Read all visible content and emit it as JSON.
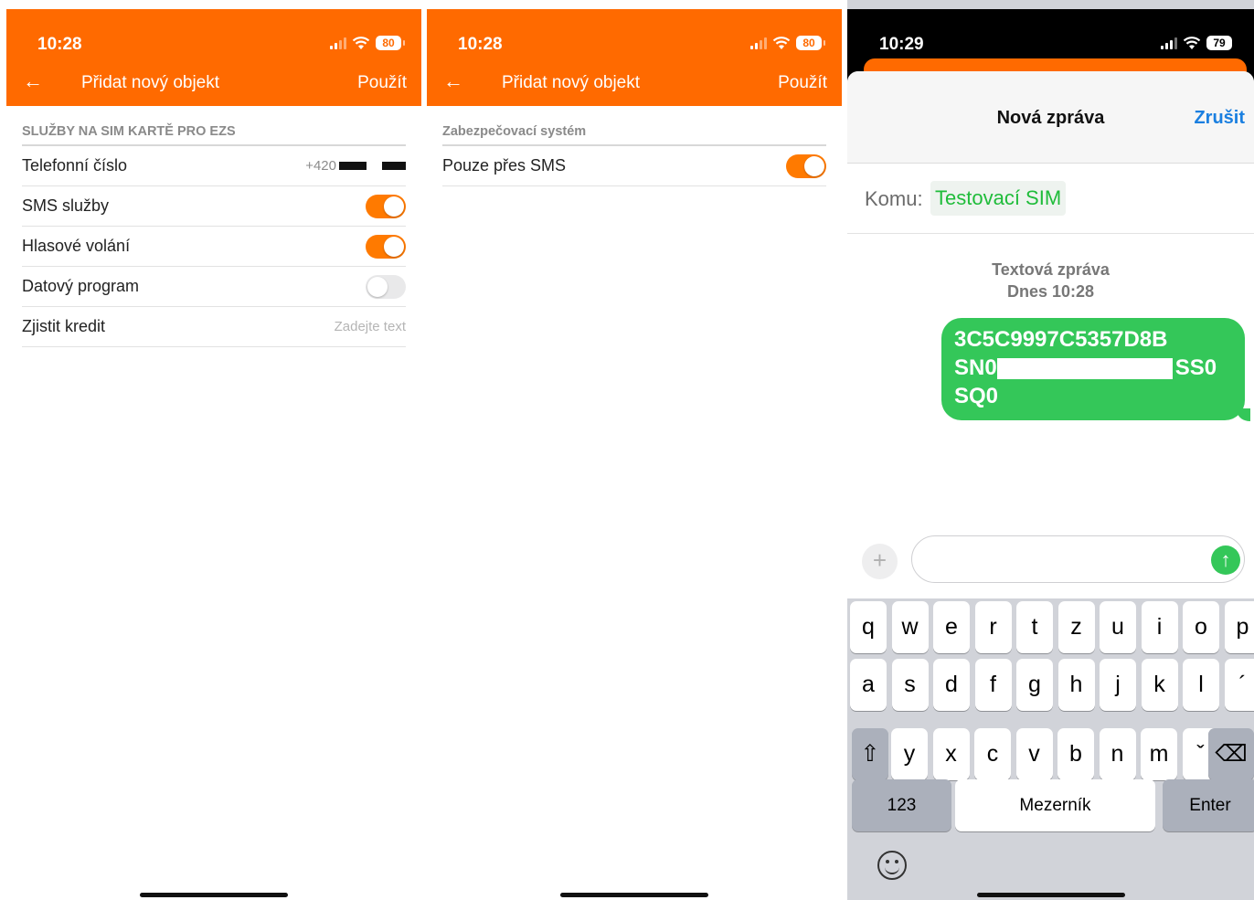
{
  "screen1": {
    "status": {
      "time": "10:28",
      "battery": "80"
    },
    "nav": {
      "title": "Přidat nový objekt",
      "action": "Použít"
    },
    "section_header": "SLUŽBY NA SIM KARTĚ PRO EZS",
    "rows": [
      {
        "label": "Telefonní číslo",
        "value": "+420"
      },
      {
        "label": "SMS služby",
        "toggle": true
      },
      {
        "label": "Hlasové volání",
        "toggle": true
      },
      {
        "label": "Datový program",
        "toggle": false
      },
      {
        "label": "Zjistit kredit",
        "placeholder": "Zadejte text"
      }
    ]
  },
  "screen2": {
    "status": {
      "time": "10:28",
      "battery": "80"
    },
    "nav": {
      "title": "Přidat nový objekt",
      "action": "Použít"
    },
    "section_header": "Zabezpečovací systém",
    "rows": [
      {
        "label": "Pouze přes SMS",
        "toggle": true
      }
    ]
  },
  "screen3": {
    "status": {
      "time": "10:29",
      "battery": "79"
    },
    "sheet": {
      "title": "Nová zpráva",
      "cancel": "Zrušit"
    },
    "to": {
      "label": "Komu:",
      "recipient": "Testovací SIM"
    },
    "message_meta": {
      "type": "Textová zpráva",
      "time": "Dnes 10:28"
    },
    "message": {
      "line1": "3C5C9997C5357D8B",
      "line2_start": "SN0",
      "line2_end": "SS0",
      "line3": "SQ0"
    },
    "keyboard": {
      "row1": [
        "q",
        "w",
        "e",
        "r",
        "t",
        "z",
        "u",
        "i",
        "o",
        "p"
      ],
      "row2": [
        "a",
        "s",
        "d",
        "f",
        "g",
        "h",
        "j",
        "k",
        "l",
        "´"
      ],
      "row3": [
        "y",
        "x",
        "c",
        "v",
        "b",
        "n",
        "m",
        "ˇ"
      ],
      "numbers": "123",
      "space": "Mezerník",
      "enter": "Enter"
    }
  },
  "colors": {
    "brand_orange": "#ff6a00",
    "toggle_on": "#ff7a00",
    "imessage_green": "#34c759",
    "link_blue": "#1a7fe0"
  },
  "icons": [
    "back-arrow-icon",
    "signal-icon",
    "wifi-icon",
    "battery-icon",
    "plus-icon",
    "send-arrow-icon",
    "shift-icon",
    "delete-icon",
    "emoji-icon"
  ]
}
